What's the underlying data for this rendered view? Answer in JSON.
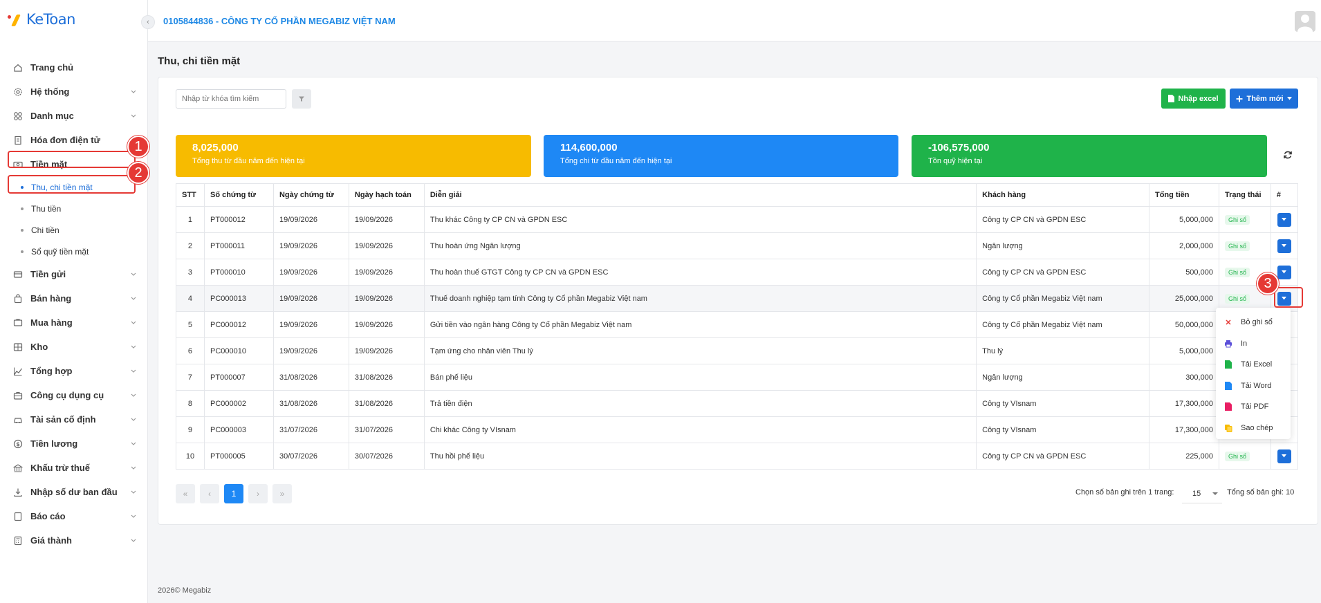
{
  "app": {
    "logo_text": "KeToan",
    "company": "0105844836 - CÔNG TY CỔ PHẦN MEGABIZ VIỆT NAM"
  },
  "sidebar": {
    "items": [
      {
        "label": "Trang chủ",
        "icon": "home-icon"
      },
      {
        "label": "Hệ thống",
        "icon": "gear-icon"
      },
      {
        "label": "Danh mục",
        "icon": "grid-icon"
      },
      {
        "label": "Hóa đơn điện tử",
        "icon": "invoice-icon"
      },
      {
        "label": "Tiền mặt",
        "icon": "cash-icon"
      },
      {
        "label": "Tiền gửi",
        "icon": "bank-icon"
      },
      {
        "label": "Bán hàng",
        "icon": "bag-icon"
      },
      {
        "label": "Mua hàng",
        "icon": "cart-icon"
      },
      {
        "label": "Kho",
        "icon": "warehouse-icon"
      },
      {
        "label": "Tổng hợp",
        "icon": "chart-icon"
      },
      {
        "label": "Công cụ dụng cụ",
        "icon": "tools-icon"
      },
      {
        "label": "Tài sản cố định",
        "icon": "car-icon"
      },
      {
        "label": "Tiền lương",
        "icon": "dollar-icon"
      },
      {
        "label": "Khấu trừ thuế",
        "icon": "tax-icon"
      },
      {
        "label": "Nhập số dư ban đầu",
        "icon": "import-icon"
      },
      {
        "label": "Báo cáo",
        "icon": "report-icon"
      },
      {
        "label": "Giá thành",
        "icon": "calculator-icon"
      }
    ],
    "sub_items": [
      "Thu, chi tiền mặt",
      "Thu tiền",
      "Chi tiền",
      "Sổ quỹ tiền mặt"
    ]
  },
  "page": {
    "title": "Thu, chi tiền mặt"
  },
  "toolbar": {
    "search_placeholder": "Nhập từ khóa tìm kiếm",
    "import_excel_label": "Nhập excel",
    "add_new_label": "Thêm mới"
  },
  "stats": [
    {
      "value": "8,025,000",
      "label": "Tổng thu từ đầu năm đến hiện tại",
      "color": "#f7bb00"
    },
    {
      "value": "114,600,000",
      "label": "Tổng chi từ đầu năm đến hiện tại",
      "color": "#1e88f5"
    },
    {
      "value": "-106,575,000",
      "label": "Tồn quỹ hiện tại",
      "color": "#1fb34a"
    }
  ],
  "table": {
    "headers": [
      "STT",
      "Số chứng từ",
      "Ngày chứng từ",
      "Ngày hạch toán",
      "Diễn giải",
      "Khách hàng",
      "Tổng tiền",
      "Trạng thái",
      "#"
    ],
    "rows": [
      {
        "stt": "1",
        "so": "PT000012",
        "ngay_ct": "19/09/2026",
        "ngay_ht": "19/09/2026",
        "dien_giai": "Thu khác Công ty CP CN và GPDN ESC",
        "khach_hang": "Công ty CP CN và GPDN ESC",
        "tong_tien": "5,000,000",
        "trang_thai": "Ghi sổ"
      },
      {
        "stt": "2",
        "so": "PT000011",
        "ngay_ct": "19/09/2026",
        "ngay_ht": "19/09/2026",
        "dien_giai": "Thu hoàn ứng Ngân lượng",
        "khach_hang": "Ngân lượng",
        "tong_tien": "2,000,000",
        "trang_thai": "Ghi sổ"
      },
      {
        "stt": "3",
        "so": "PT000010",
        "ngay_ct": "19/09/2026",
        "ngay_ht": "19/09/2026",
        "dien_giai": "Thu hoàn thuế GTGT Công ty CP CN và GPDN ESC",
        "khach_hang": "Công ty CP CN và GPDN ESC",
        "tong_tien": "500,000",
        "trang_thai": "Ghi sổ"
      },
      {
        "stt": "4",
        "so": "PC000013",
        "ngay_ct": "19/09/2026",
        "ngay_ht": "19/09/2026",
        "dien_giai": "Thuế doanh nghiệp tạm tính Công ty Cổ phần Megabiz Việt nam",
        "khach_hang": "Công ty Cổ phần Megabiz Việt nam",
        "tong_tien": "25,000,000",
        "trang_thai": "Ghi sổ"
      },
      {
        "stt": "5",
        "so": "PC000012",
        "ngay_ct": "19/09/2026",
        "ngay_ht": "19/09/2026",
        "dien_giai": "Gửi tiền vào ngân hàng Công ty Cổ phần Megabiz Việt nam",
        "khach_hang": "Công ty Cổ phần Megabiz Việt nam",
        "tong_tien": "50,000,000",
        "trang_thai": ""
      },
      {
        "stt": "6",
        "so": "PC000010",
        "ngay_ct": "19/09/2026",
        "ngay_ht": "19/09/2026",
        "dien_giai": "Tạm ứng cho nhân viên Thu lý",
        "khach_hang": "Thu lý",
        "tong_tien": "5,000,000",
        "trang_thai": ""
      },
      {
        "stt": "7",
        "so": "PT000007",
        "ngay_ct": "31/08/2026",
        "ngay_ht": "31/08/2026",
        "dien_giai": "Bán phế liệu",
        "khach_hang": "Ngân lượng",
        "tong_tien": "300,000",
        "trang_thai": ""
      },
      {
        "stt": "8",
        "so": "PC000002",
        "ngay_ct": "31/08/2026",
        "ngay_ht": "31/08/2026",
        "dien_giai": "Trả tiền điện",
        "khach_hang": "Công ty VIsnam",
        "tong_tien": "17,300,000",
        "trang_thai": ""
      },
      {
        "stt": "9",
        "so": "PC000003",
        "ngay_ct": "31/07/2026",
        "ngay_ht": "31/07/2026",
        "dien_giai": "Chi khác Công ty VIsnam",
        "khach_hang": "Công ty VIsnam",
        "tong_tien": "17,300,000",
        "trang_thai": ""
      },
      {
        "stt": "10",
        "so": "PT000005",
        "ngay_ct": "30/07/2026",
        "ngay_ht": "30/07/2026",
        "dien_giai": "Thu hồi phế liệu",
        "khach_hang": "Công ty CP CN và GPDN ESC",
        "tong_tien": "225,000",
        "trang_thai": "Ghi sổ"
      }
    ]
  },
  "dropdown": {
    "items": [
      {
        "label": "Bỏ ghi sổ",
        "icon": "close-icon",
        "color": "#e53935"
      },
      {
        "label": "In",
        "icon": "printer-icon",
        "color": "#5b4fd9"
      },
      {
        "label": "Tải Excel",
        "icon": "excel-icon",
        "color": "#1fb34a"
      },
      {
        "label": "Tải Word",
        "icon": "word-icon",
        "color": "#1e88f5"
      },
      {
        "label": "Tải PDF",
        "icon": "pdf-icon",
        "color": "#e91e63"
      },
      {
        "label": "Sao chép",
        "icon": "copy-icon",
        "color": "#f7bb00"
      }
    ]
  },
  "pagination": {
    "current_page": "1",
    "page_size_label": "Chọn số bản ghi trên 1 trang:",
    "page_size": "15",
    "total_label": "Tổng số bản ghi:",
    "total": "10"
  },
  "annotations": [
    "1",
    "2",
    "3"
  ],
  "footer": {
    "year": "2026",
    "brand": "Megabiz"
  }
}
